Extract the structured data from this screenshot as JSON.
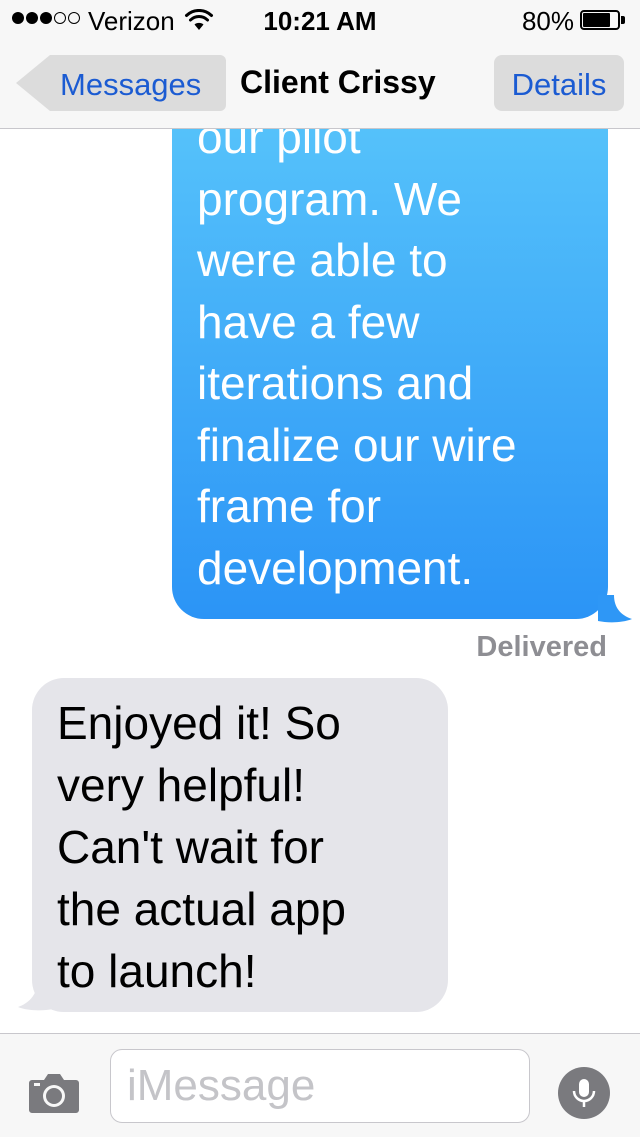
{
  "status_bar": {
    "carrier": "Verizon",
    "time": "10:21 AM",
    "battery_percent": "80%",
    "battery_level": 0.8,
    "signal_bars_filled": 3,
    "signal_bars_total": 5,
    "icons": [
      "signal-dots-icon",
      "wifi-icon",
      "battery-icon"
    ]
  },
  "nav": {
    "back_label": "Messages",
    "title": "Client Crissy",
    "details_label": "Details"
  },
  "conversation": {
    "outgoing_text": "our pilot\nprogram. We\nwere able to\nhave a few\niterations and\nfinalize our wire\nframe for\ndevelopment.",
    "delivered_label": "Delivered",
    "incoming_text": "Enjoyed it! So\nvery helpful!\nCan't wait for\nthe actual app\nto launch!"
  },
  "input": {
    "placeholder": "iMessage",
    "value": "",
    "icons": [
      "camera-icon",
      "microphone-icon"
    ]
  },
  "colors": {
    "accent": "#1b5bd2",
    "outgoing_bubble_top": "#5ac7fb",
    "outgoing_bubble_bottom": "#2b94f6",
    "incoming_bubble": "#e5e5ea",
    "delivered_text": "#8e8e93"
  }
}
